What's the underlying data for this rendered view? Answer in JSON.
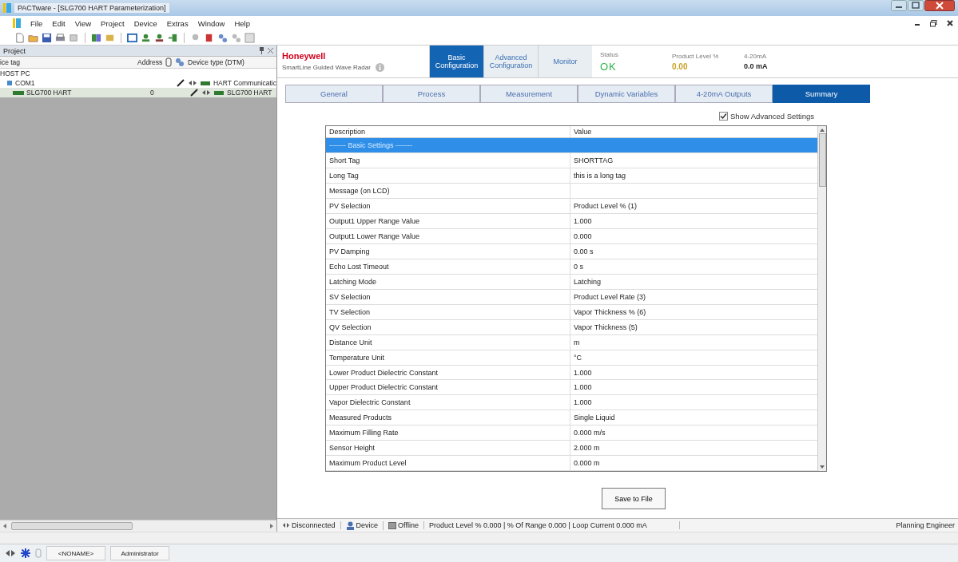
{
  "window": {
    "title": "PACTware - [SLG700 HART Parameterization]"
  },
  "menu": [
    "File",
    "Edit",
    "View",
    "Project",
    "Device",
    "Extras",
    "Window",
    "Help"
  ],
  "project": {
    "title": "Project",
    "columns": [
      "ice tag",
      "Address",
      "Device type (DTM)"
    ],
    "tree": [
      {
        "tag": "HOST PC",
        "selected": false,
        "children": [
          {
            "tag": "COM1",
            "device_type": "HART Communicatic",
            "selected": false,
            "children": [
              {
                "tag": "SLG700 HART",
                "address": "0",
                "device_type": "SLG700 HART",
                "selected": true
              }
            ]
          }
        ]
      }
    ]
  },
  "device_header": {
    "brand": "Honeywell",
    "product": "SmartLine Guided Wave Radar",
    "tabs": [
      {
        "label": "Basic Configuration",
        "selected": true
      },
      {
        "label": "Advanced Configuration",
        "selected": false
      },
      {
        "label": "Monitor",
        "selected": false
      }
    ],
    "readouts": [
      {
        "label": "Status",
        "value": "OK",
        "color": "#2fb34a"
      },
      {
        "label": "Product Level %",
        "value": "0.00",
        "color": "#c9a227"
      },
      {
        "label": "4-20mA",
        "value": "0.0 mA",
        "color": "#222222"
      }
    ]
  },
  "sub_tabs": [
    {
      "label": "General",
      "selected": false
    },
    {
      "label": "Process",
      "selected": false
    },
    {
      "label": "Measurement",
      "selected": false
    },
    {
      "label": "Dynamic Variables",
      "selected": false
    },
    {
      "label": "4-20mA Outputs",
      "selected": false
    },
    {
      "label": "Summary",
      "selected": true
    }
  ],
  "show_advanced": {
    "label": "Show Advanced Settings",
    "checked": true
  },
  "table": {
    "columns": [
      "Description",
      "Value"
    ],
    "rows": [
      {
        "kind": "section",
        "description": "------- Basic Settings -------",
        "value": "",
        "selected": true
      },
      {
        "kind": "item",
        "description": "Short Tag",
        "value": "SHORTTAG",
        "selected": false
      },
      {
        "kind": "item",
        "description": "Long Tag",
        "value": "this is a long tag",
        "selected": false
      },
      {
        "kind": "item",
        "description": "Message (on LCD)",
        "value": "",
        "selected": false
      },
      {
        "kind": "item",
        "description": "PV Selection",
        "value": "Product Level % (1)",
        "selected": false
      },
      {
        "kind": "item",
        "description": "Output1 Upper Range Value",
        "value": "1.000",
        "selected": false
      },
      {
        "kind": "item",
        "description": "Output1 Lower Range Value",
        "value": "0.000",
        "selected": false
      },
      {
        "kind": "item",
        "description": "PV Damping",
        "value": "0.00 s",
        "selected": false
      },
      {
        "kind": "item",
        "description": "Echo Lost Timeout",
        "value": "0 s",
        "selected": false
      },
      {
        "kind": "item",
        "description": "Latching Mode",
        "value": "Latching",
        "selected": false
      },
      {
        "kind": "item",
        "description": "SV Selection",
        "value": "Product Level Rate (3)",
        "selected": false
      },
      {
        "kind": "item",
        "description": "TV Selection",
        "value": "Vapor Thickness % (6)",
        "selected": false
      },
      {
        "kind": "item",
        "description": "QV Selection",
        "value": "Vapor Thickness (5)",
        "selected": false
      },
      {
        "kind": "item",
        "description": "Distance Unit",
        "value": "m",
        "selected": false
      },
      {
        "kind": "item",
        "description": "Temperature Unit",
        "value": "°C",
        "selected": false
      },
      {
        "kind": "item",
        "description": "Lower Product Dielectric Constant",
        "value": "1.000",
        "selected": false
      },
      {
        "kind": "item",
        "description": "Upper Product Dielectric Constant",
        "value": "1.000",
        "selected": false
      },
      {
        "kind": "item",
        "description": "Vapor Dielectric Constant",
        "value": "1.000",
        "selected": false
      },
      {
        "kind": "item",
        "description": "Measured Products",
        "value": "Single Liquid",
        "selected": false
      },
      {
        "kind": "item",
        "description": "Maximum Filling Rate",
        "value": "0.000 m/s",
        "selected": false
      },
      {
        "kind": "item",
        "description": "Sensor Height",
        "value": "2.000 m",
        "selected": false
      },
      {
        "kind": "item",
        "description": "Maximum Product Level",
        "value": "0.000 m",
        "selected": false
      }
    ]
  },
  "save_button": "Save to File",
  "status_bar": {
    "connection": "Disconnected",
    "device": "Device",
    "mode": "Offline",
    "readings": "Product Level % 0.000  | % Of Range 0.000 | Loop Current 0.000 mA",
    "role": "Planning Engineer"
  },
  "taskbar": {
    "project": "<NONAME>",
    "user": "Administrator"
  }
}
